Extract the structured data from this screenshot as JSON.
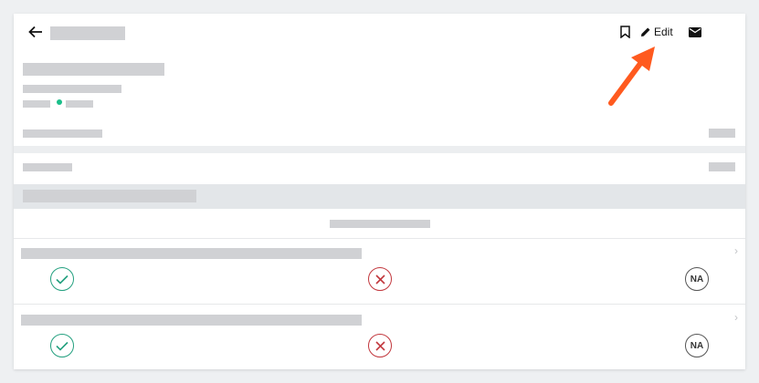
{
  "header": {
    "back_icon": "arrow-left-icon",
    "bookmark_icon": "bookmark-icon",
    "edit_label": "Edit",
    "edit_icon": "pencil-icon",
    "mail_icon": "envelope-icon"
  },
  "status_dot_color": "#1bbf8a",
  "items": [
    {
      "options": [
        {
          "kind": "pass",
          "icon": "check-circle-icon"
        },
        {
          "kind": "fail",
          "icon": "x-circle-icon"
        },
        {
          "kind": "na",
          "label": "NA"
        }
      ]
    },
    {
      "options": [
        {
          "kind": "pass",
          "icon": "check-circle-icon"
        },
        {
          "kind": "fail",
          "icon": "x-circle-icon"
        },
        {
          "kind": "na",
          "label": "NA"
        }
      ]
    }
  ],
  "annotation": {
    "arrow_color": "#ff5a1f"
  }
}
